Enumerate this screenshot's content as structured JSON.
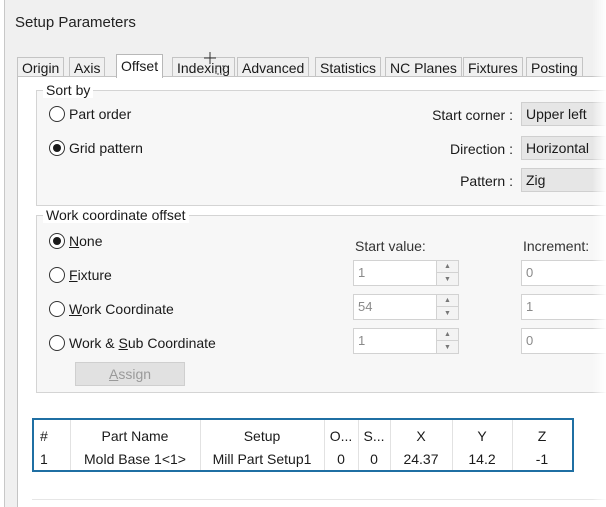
{
  "window": {
    "title": "Setup Parameters"
  },
  "tabs": [
    {
      "label": "Origin"
    },
    {
      "label": "Axis"
    },
    {
      "label": "Offset"
    },
    {
      "label": "Indexing"
    },
    {
      "label": "Advanced"
    },
    {
      "label": "Statistics"
    },
    {
      "label": "NC Planes"
    },
    {
      "label": "Fixtures"
    },
    {
      "label": "Posting"
    }
  ],
  "sort_by": {
    "legend": "Sort by",
    "part_order": "Part order",
    "grid_pattern": "Grid pattern",
    "start_corner_label": "Start corner :",
    "start_corner_value": "Upper left",
    "direction_label": "Direction :",
    "direction_value": "Horizontal",
    "pattern_label": "Pattern :",
    "pattern_value": "Zig"
  },
  "work_offset": {
    "legend": "Work coordinate offset",
    "none_a": "N",
    "none_b": "one",
    "fixture_a": "F",
    "fixture_b": "ixture",
    "work_a": "W",
    "work_b": "ork Coordinate",
    "worksub_a": "Work & ",
    "worksub_b": "S",
    "worksub_c": "ub Coordinate",
    "start_value_label": "Start value:",
    "increment_label": "Increment:",
    "fixture_start": "1",
    "fixture_inc": "0",
    "work_start": "54",
    "work_inc": "1",
    "worksub_start": "1",
    "worksub_inc": "0",
    "assign_a": "A",
    "assign_b": "ssign"
  },
  "table": {
    "headers": [
      "#",
      "Part Name",
      "Setup",
      "O...",
      "S...",
      "X",
      "Y",
      "Z"
    ],
    "rows": [
      [
        "1",
        "Mold Base 1<1>",
        "Mill Part Setup1",
        "0",
        "0",
        "24.37",
        "14.2",
        "-1"
      ]
    ]
  }
}
